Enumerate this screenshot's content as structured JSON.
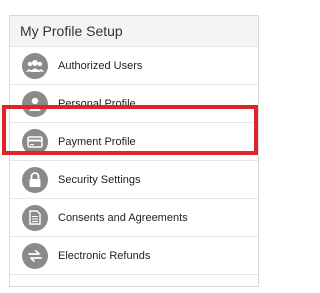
{
  "panel": {
    "title": "My Profile Setup",
    "items": [
      {
        "label": "Authorized Users",
        "icon": "users-icon"
      },
      {
        "label": "Personal Profile",
        "icon": "person-icon"
      },
      {
        "label": "Payment Profile",
        "icon": "credit-card-icon"
      },
      {
        "label": "Security Settings",
        "icon": "lock-icon"
      },
      {
        "label": "Consents and Agreements",
        "icon": "document-icon"
      },
      {
        "label": "Electronic Refunds",
        "icon": "refund-icon"
      }
    ]
  },
  "colors": {
    "icon_bg": "#8a8a8a",
    "highlight": "#e0242b",
    "header_bg": "#f4f4f4"
  }
}
